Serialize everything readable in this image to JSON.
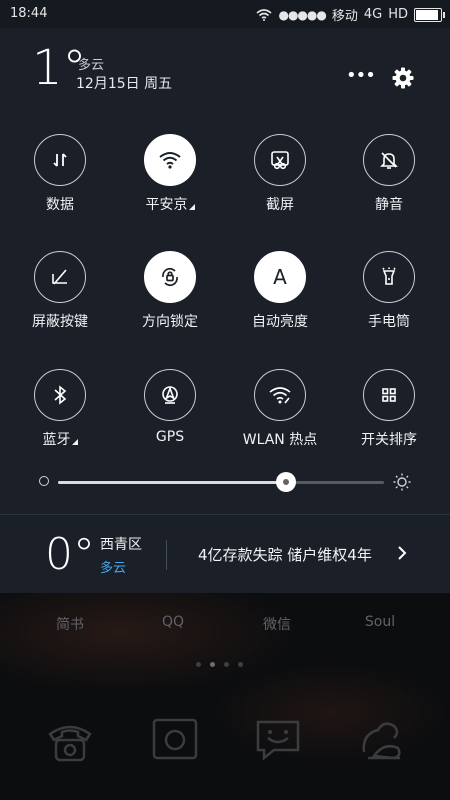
{
  "status_bar": {
    "time": "18:44",
    "carrier": "移动",
    "network": "4G",
    "hd": "HD",
    "battery_level": 1.0
  },
  "header": {
    "temperature": "1°",
    "weather": "多云",
    "date": "12月15日 周五"
  },
  "toggles": [
    {
      "label": "数据",
      "icon": "mobile-data-icon",
      "active": false,
      "expandable": false
    },
    {
      "label": "平安京",
      "icon": "wifi-icon",
      "active": true,
      "expandable": true
    },
    {
      "label": "截屏",
      "icon": "screenshot-icon",
      "active": false,
      "expandable": false
    },
    {
      "label": "静音",
      "icon": "mute-bell-icon",
      "active": false,
      "expandable": false
    },
    {
      "label": "屏蔽按键",
      "icon": "block-keys-icon",
      "active": false,
      "expandable": false
    },
    {
      "label": "方向锁定",
      "icon": "rotation-lock-icon",
      "active": true,
      "expandable": false
    },
    {
      "label": "自动亮度",
      "icon": "auto-brightness-icon",
      "active": true,
      "expandable": false
    },
    {
      "label": "手电筒",
      "icon": "flashlight-icon",
      "active": false,
      "expandable": false
    },
    {
      "label": "蓝牙",
      "icon": "bluetooth-icon",
      "active": false,
      "expandable": true
    },
    {
      "label": "GPS",
      "icon": "gps-icon",
      "active": false,
      "expandable": false
    },
    {
      "label": "WLAN 热点",
      "icon": "hotspot-icon",
      "active": false,
      "expandable": false
    },
    {
      "label": "开关排序",
      "icon": "grid-sort-icon",
      "active": false,
      "expandable": false
    }
  ],
  "auto_brightness_glyph": "A",
  "brightness": {
    "level": 0.7
  },
  "weather_card": {
    "temperature": "0°",
    "district": "西青区",
    "condition": "多云",
    "news": "4亿存款失踪 储户维权4年"
  },
  "home_apps": [
    "简书",
    "QQ",
    "微信",
    "Soul"
  ],
  "page_indicator": {
    "count": 4,
    "active": 1
  },
  "dock": [
    "phone-icon",
    "camera-icon",
    "messages-icon",
    "uc-browser-icon"
  ],
  "colors": {
    "accent_blue": "#3fa7ef",
    "panel_bg": "#1b2028",
    "active_toggle": "#ffffff"
  }
}
